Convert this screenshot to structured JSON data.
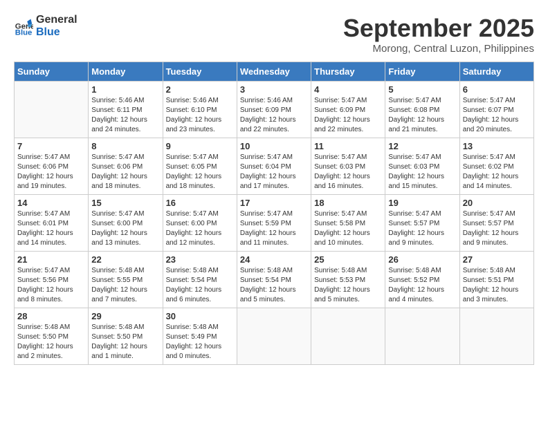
{
  "logo": {
    "line1": "General",
    "line2": "Blue"
  },
  "title": "September 2025",
  "subtitle": "Morong, Central Luzon, Philippines",
  "days_of_week": [
    "Sunday",
    "Monday",
    "Tuesday",
    "Wednesday",
    "Thursday",
    "Friday",
    "Saturday"
  ],
  "weeks": [
    [
      {
        "day": "",
        "info": ""
      },
      {
        "day": "1",
        "info": "Sunrise: 5:46 AM\nSunset: 6:11 PM\nDaylight: 12 hours\nand 24 minutes."
      },
      {
        "day": "2",
        "info": "Sunrise: 5:46 AM\nSunset: 6:10 PM\nDaylight: 12 hours\nand 23 minutes."
      },
      {
        "day": "3",
        "info": "Sunrise: 5:46 AM\nSunset: 6:09 PM\nDaylight: 12 hours\nand 22 minutes."
      },
      {
        "day": "4",
        "info": "Sunrise: 5:47 AM\nSunset: 6:09 PM\nDaylight: 12 hours\nand 22 minutes."
      },
      {
        "day": "5",
        "info": "Sunrise: 5:47 AM\nSunset: 6:08 PM\nDaylight: 12 hours\nand 21 minutes."
      },
      {
        "day": "6",
        "info": "Sunrise: 5:47 AM\nSunset: 6:07 PM\nDaylight: 12 hours\nand 20 minutes."
      }
    ],
    [
      {
        "day": "7",
        "info": "Sunrise: 5:47 AM\nSunset: 6:06 PM\nDaylight: 12 hours\nand 19 minutes."
      },
      {
        "day": "8",
        "info": "Sunrise: 5:47 AM\nSunset: 6:06 PM\nDaylight: 12 hours\nand 18 minutes."
      },
      {
        "day": "9",
        "info": "Sunrise: 5:47 AM\nSunset: 6:05 PM\nDaylight: 12 hours\nand 18 minutes."
      },
      {
        "day": "10",
        "info": "Sunrise: 5:47 AM\nSunset: 6:04 PM\nDaylight: 12 hours\nand 17 minutes."
      },
      {
        "day": "11",
        "info": "Sunrise: 5:47 AM\nSunset: 6:03 PM\nDaylight: 12 hours\nand 16 minutes."
      },
      {
        "day": "12",
        "info": "Sunrise: 5:47 AM\nSunset: 6:03 PM\nDaylight: 12 hours\nand 15 minutes."
      },
      {
        "day": "13",
        "info": "Sunrise: 5:47 AM\nSunset: 6:02 PM\nDaylight: 12 hours\nand 14 minutes."
      }
    ],
    [
      {
        "day": "14",
        "info": "Sunrise: 5:47 AM\nSunset: 6:01 PM\nDaylight: 12 hours\nand 14 minutes."
      },
      {
        "day": "15",
        "info": "Sunrise: 5:47 AM\nSunset: 6:00 PM\nDaylight: 12 hours\nand 13 minutes."
      },
      {
        "day": "16",
        "info": "Sunrise: 5:47 AM\nSunset: 6:00 PM\nDaylight: 12 hours\nand 12 minutes."
      },
      {
        "day": "17",
        "info": "Sunrise: 5:47 AM\nSunset: 5:59 PM\nDaylight: 12 hours\nand 11 minutes."
      },
      {
        "day": "18",
        "info": "Sunrise: 5:47 AM\nSunset: 5:58 PM\nDaylight: 12 hours\nand 10 minutes."
      },
      {
        "day": "19",
        "info": "Sunrise: 5:47 AM\nSunset: 5:57 PM\nDaylight: 12 hours\nand 9 minutes."
      },
      {
        "day": "20",
        "info": "Sunrise: 5:47 AM\nSunset: 5:57 PM\nDaylight: 12 hours\nand 9 minutes."
      }
    ],
    [
      {
        "day": "21",
        "info": "Sunrise: 5:47 AM\nSunset: 5:56 PM\nDaylight: 12 hours\nand 8 minutes."
      },
      {
        "day": "22",
        "info": "Sunrise: 5:48 AM\nSunset: 5:55 PM\nDaylight: 12 hours\nand 7 minutes."
      },
      {
        "day": "23",
        "info": "Sunrise: 5:48 AM\nSunset: 5:54 PM\nDaylight: 12 hours\nand 6 minutes."
      },
      {
        "day": "24",
        "info": "Sunrise: 5:48 AM\nSunset: 5:54 PM\nDaylight: 12 hours\nand 5 minutes."
      },
      {
        "day": "25",
        "info": "Sunrise: 5:48 AM\nSunset: 5:53 PM\nDaylight: 12 hours\nand 5 minutes."
      },
      {
        "day": "26",
        "info": "Sunrise: 5:48 AM\nSunset: 5:52 PM\nDaylight: 12 hours\nand 4 minutes."
      },
      {
        "day": "27",
        "info": "Sunrise: 5:48 AM\nSunset: 5:51 PM\nDaylight: 12 hours\nand 3 minutes."
      }
    ],
    [
      {
        "day": "28",
        "info": "Sunrise: 5:48 AM\nSunset: 5:50 PM\nDaylight: 12 hours\nand 2 minutes."
      },
      {
        "day": "29",
        "info": "Sunrise: 5:48 AM\nSunset: 5:50 PM\nDaylight: 12 hours\nand 1 minute."
      },
      {
        "day": "30",
        "info": "Sunrise: 5:48 AM\nSunset: 5:49 PM\nDaylight: 12 hours\nand 0 minutes."
      },
      {
        "day": "",
        "info": ""
      },
      {
        "day": "",
        "info": ""
      },
      {
        "day": "",
        "info": ""
      },
      {
        "day": "",
        "info": ""
      }
    ]
  ]
}
